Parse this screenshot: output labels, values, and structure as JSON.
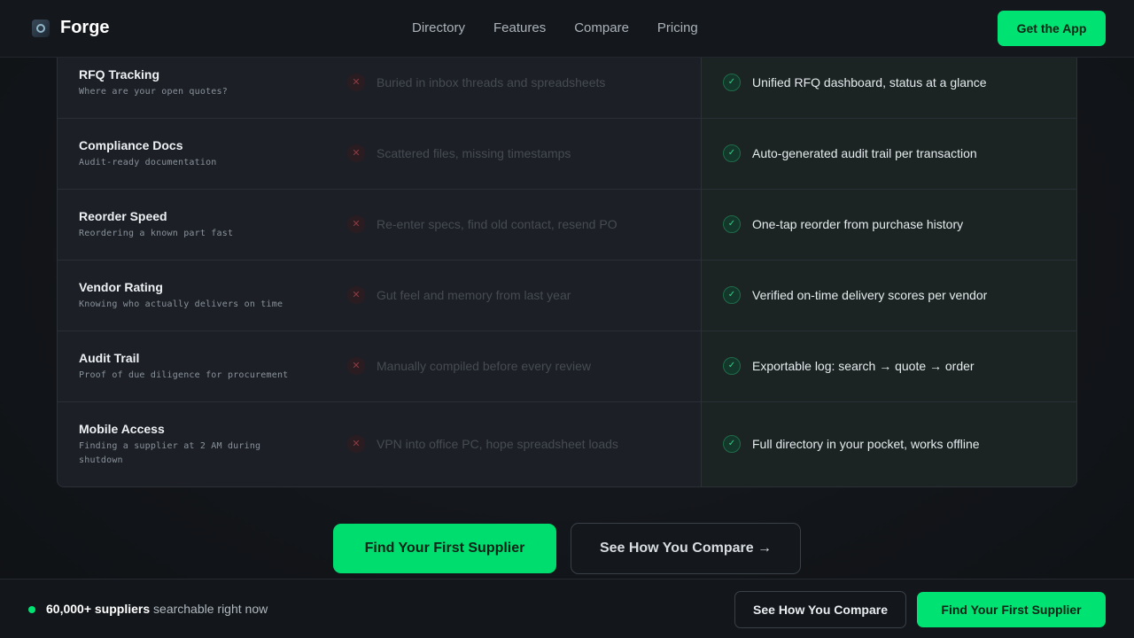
{
  "header": {
    "brand": "Forge",
    "nav": [
      "Directory",
      "Features",
      "Compare",
      "Pricing"
    ],
    "cta": "Get the App"
  },
  "comparison": {
    "rows": [
      {
        "title": "RFQ Tracking",
        "subtitle": "Where are your open quotes?",
        "old": "Buried in inbox threads and spreadsheets",
        "new": "Unified RFQ dashboard, status at a glance"
      },
      {
        "title": "Compliance Docs",
        "subtitle": "Audit-ready documentation",
        "old": "Scattered files, missing timestamps",
        "new": "Auto-generated audit trail per transaction"
      },
      {
        "title": "Reorder Speed",
        "subtitle": "Reordering a known part fast",
        "old": "Re-enter specs, find old contact, resend PO",
        "new": "One-tap reorder from purchase history"
      },
      {
        "title": "Vendor Rating",
        "subtitle": "Knowing who actually delivers on time",
        "old": "Gut feel and memory from last year",
        "new": "Verified on-time delivery scores per vendor"
      },
      {
        "title": "Audit Trail",
        "subtitle": "Proof of due diligence for procurement",
        "old": "Manually compiled before every review",
        "new": "Exportable log: search → quote → order"
      },
      {
        "title": "Mobile Access",
        "subtitle": "Finding a supplier at 2 AM during shutdown",
        "old": "VPN into office PC, hope spreadsheet loads",
        "new": "Full directory in your pocket, works offline"
      }
    ],
    "old_icon": "x-icon",
    "new_icon": "check-icon"
  },
  "cta": {
    "primary": "Find Your First Supplier",
    "secondary": "See How You Compare →"
  },
  "sticky_bar": {
    "count": "60,000+ suppliers",
    "rest": " searchable right now",
    "secondary": "See How You Compare",
    "primary": "Find Your First Supplier"
  },
  "colors": {
    "accent": "#00e272",
    "background": "#111418"
  }
}
